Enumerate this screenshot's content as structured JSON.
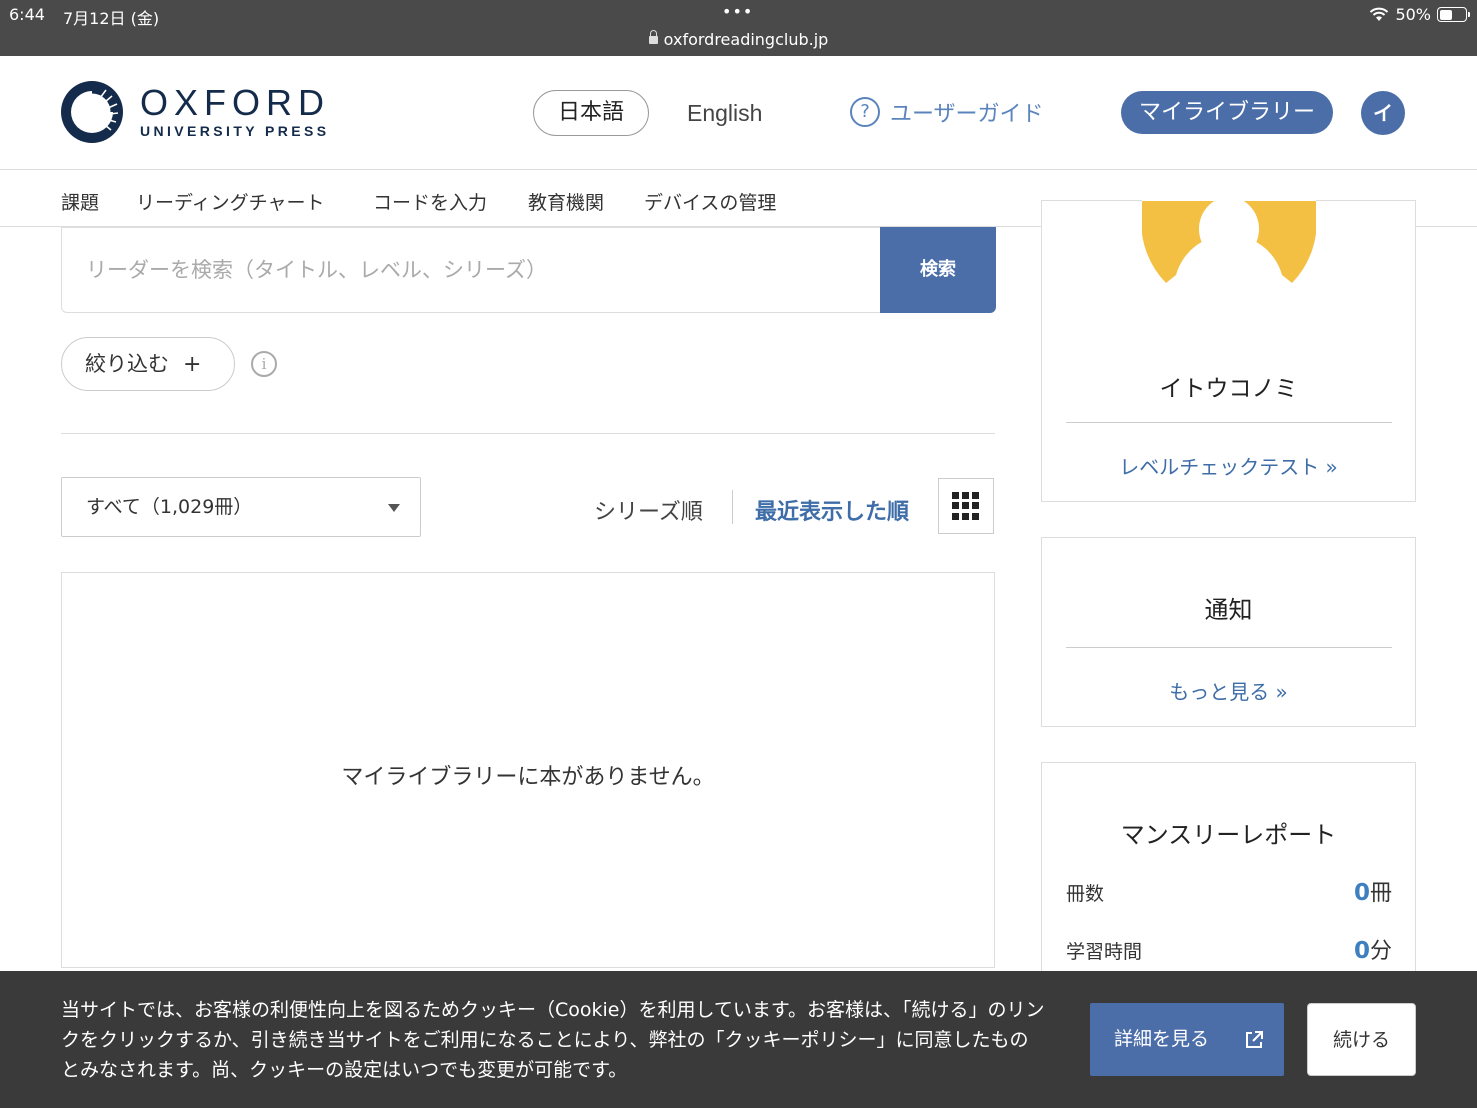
{
  "status_bar": {
    "time": "6:44",
    "date": "7月12日 (金)",
    "dots": "•••",
    "url": "oxfordreadingclub.jp",
    "battery": "50%"
  },
  "header": {
    "logo_line1": "OXFORD",
    "logo_line2": "UNIVERSITY PRESS",
    "lang_ja": "日本語",
    "lang_en": "English",
    "guide_icon": "?",
    "user_guide": "ユーザーガイド",
    "my_library": "マイライブラリー",
    "avatar_initial": "イ"
  },
  "nav": {
    "items": [
      "課題",
      "リーディングチャート",
      "コードを入力",
      "教育機関",
      "デバイスの管理"
    ]
  },
  "search": {
    "placeholder": "リーダーを検索（タイトル、レベル、シリーズ）",
    "button": "検索"
  },
  "filter": {
    "label": "絞り込む",
    "plus": "+",
    "info_glyph": "i"
  },
  "library": {
    "select_value": "すべて（1,029冊）",
    "sort_series": "シリーズ順",
    "sort_recent": "最近表示した順",
    "empty_message": "マイライブラリーに本がありません。"
  },
  "sidebar": {
    "profile": {
      "name": "イトウコノミ",
      "link": "レベルチェックテスト »",
      "avatar_color": "#f3c044"
    },
    "notice": {
      "title": "通知",
      "link": "もっと見る »"
    },
    "report": {
      "title": "マンスリーレポート",
      "rows": [
        {
          "label": "冊数",
          "value": "0",
          "unit": "冊"
        },
        {
          "label": "学習時間",
          "value": "0",
          "unit": "分"
        }
      ]
    }
  },
  "cookie": {
    "text": "当サイトでは、お客様の利便性向上を図るためクッキー（Cookie）を利用しています。お客様は、「続ける」のリンクをクリックするか、引き続き当サイトをご利用になることにより、弊社の「クッキーポリシー」に同意したものとみなされます。尚、クッキーの設定はいつでも変更が可能です。",
    "detail_button": "詳細を見る",
    "continue_button": "続ける"
  },
  "colors": {
    "brand_blue": "#4b6ea9",
    "link_blue": "#3e6da8",
    "oxford_navy": "#142b4b"
  }
}
